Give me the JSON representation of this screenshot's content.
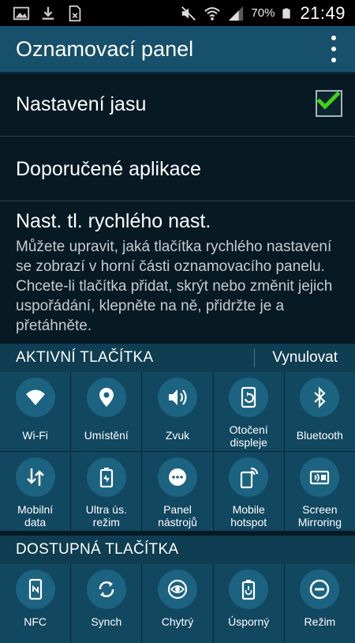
{
  "status_bar": {
    "battery_percent": "70%",
    "time": "21:49",
    "icons": [
      "gallery-icon",
      "download-icon",
      "sim-card-icon",
      "mute-icon",
      "wifi-icon",
      "signal-icon",
      "battery-icon"
    ]
  },
  "action_bar": {
    "title": "Oznamovací panel",
    "menu_icon": "overflow-menu-icon"
  },
  "settings": {
    "brightness": {
      "label": "Nastavení jasu",
      "checked": true
    },
    "recommended_apps": {
      "label": "Doporučené aplikace"
    },
    "quick_settings": {
      "label": "Nast. tl. rychlého nast.",
      "description": "Můžete upravit, jaká tlačítka rychlého nastavení se zobrazí v horní části oznamovacího panelu. Chcete-li tlačítka přidat, skrýt nebo změnit jejich uspořádání, klepněte na ně, přidržte je a přetáhněte."
    }
  },
  "active_section": {
    "title": "AKTIVNÍ TLAČÍTKA",
    "reset_label": "Vynulovat",
    "tiles": [
      {
        "label": "Wi-Fi",
        "icon": "wifi-icon"
      },
      {
        "label": "Umístění",
        "icon": "location-icon"
      },
      {
        "label": "Zvuk",
        "icon": "sound-icon"
      },
      {
        "label": "Otočení\ndispleje",
        "icon": "screen-rotation-icon"
      },
      {
        "label": "Bluetooth",
        "icon": "bluetooth-icon"
      },
      {
        "label": "Mobilní\ndata",
        "icon": "mobile-data-icon"
      },
      {
        "label": "Ultra ús.\nrežim",
        "icon": "ultra-power-saving-icon"
      },
      {
        "label": "Panel\nnástrojů",
        "icon": "toolbox-icon"
      },
      {
        "label": "Mobile\nhotspot",
        "icon": "hotspot-icon"
      },
      {
        "label": "Screen\nMirroring",
        "icon": "screen-mirroring-icon"
      }
    ]
  },
  "available_section": {
    "title": "DOSTUPNÁ TLAČÍTKA",
    "tiles": [
      {
        "label": "NFC",
        "icon": "nfc-icon"
      },
      {
        "label": "Synch",
        "icon": "sync-icon"
      },
      {
        "label": "Chytrý",
        "icon": "smart-stay-icon"
      },
      {
        "label": "Úsporný",
        "icon": "power-saving-icon"
      },
      {
        "label": "Režim",
        "icon": "blocking-mode-icon"
      }
    ]
  },
  "colors": {
    "accent_check": "#3fd414",
    "action_bar": "#17506a",
    "tile": "#124760"
  }
}
